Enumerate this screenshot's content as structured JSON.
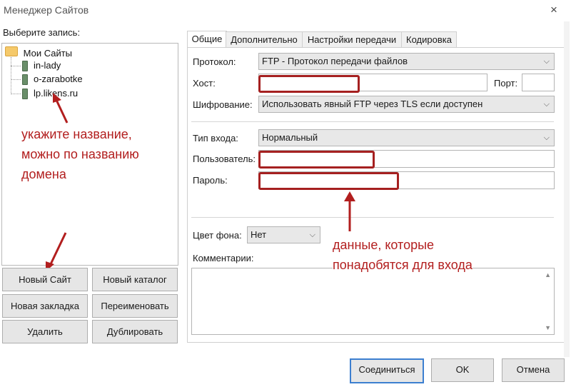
{
  "window": {
    "title": "Менеджер Сайтов",
    "close_icon": "×"
  },
  "left": {
    "select_label": "Выберите запись:",
    "tree": {
      "root": "Мои Сайты",
      "items": [
        "in-lady",
        "o-zarabotke",
        "lp.likens.ru"
      ]
    },
    "buttons": {
      "new_site": "Новый Сайт",
      "new_folder": "Новый каталог",
      "new_bookmark": "Новая закладка",
      "rename": "Переименовать",
      "delete": "Удалить",
      "duplicate": "Дублировать"
    }
  },
  "tabs": [
    "Общие",
    "Дополнительно",
    "Настройки передачи",
    "Кодировка"
  ],
  "form": {
    "protocol_label": "Протокол:",
    "protocol_value": "FTP - Протокол передачи файлов",
    "host_label": "Хост:",
    "host_value": "",
    "port_label": "Порт:",
    "port_value": "",
    "encryption_label": "Шифрование:",
    "encryption_value": "Использовать явный FTP через TLS если доступен",
    "logon_label": "Тип входа:",
    "logon_value": "Нормальный",
    "user_label": "Пользователь:",
    "user_value": "",
    "password_label": "Пароль:",
    "password_value": "",
    "bgcolor_label": "Цвет фона:",
    "bgcolor_value": "Нет",
    "comments_label": "Комментарии:"
  },
  "annotations": {
    "name_hint": "укажите название,\nможно по названию\nдомена",
    "login_hint": "данные, которые\nпонадобятся для входа",
    "color": "#b21e1e"
  },
  "dialog_buttons": {
    "connect": "Соединиться",
    "ok": "OK",
    "cancel": "Отмена"
  }
}
